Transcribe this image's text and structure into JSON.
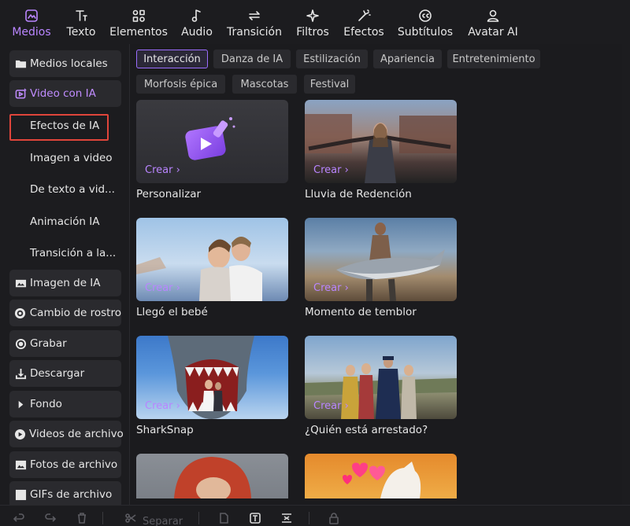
{
  "toolbar": {
    "items": [
      {
        "label": "Medios",
        "icon": "media-icon",
        "active": true
      },
      {
        "label": "Texto",
        "icon": "text-icon"
      },
      {
        "label": "Elementos",
        "icon": "elements-icon"
      },
      {
        "label": "Audio",
        "icon": "music-note-icon"
      },
      {
        "label": "Transición",
        "icon": "transition-arrows-icon"
      },
      {
        "label": "Filtros",
        "icon": "sparkle-icon"
      },
      {
        "label": "Efectos",
        "icon": "magic-effects-icon"
      },
      {
        "label": "Subtítulos",
        "icon": "subtitles-cc-icon"
      },
      {
        "label": "Avatar AI",
        "icon": "avatar-icon"
      }
    ]
  },
  "sidebar": {
    "local_media": "Medios locales",
    "video_ai": "Video con IA",
    "sub_items": [
      "Efectos de IA",
      "Imagen a video",
      "De texto a vid...",
      "Animación IA",
      "Transición a la..."
    ],
    "items": [
      {
        "label": "Imagen de IA",
        "icon": "ai-image-icon"
      },
      {
        "label": "Cambio de rostro",
        "icon": "face-swap-icon"
      },
      {
        "label": "Grabar",
        "icon": "record-icon"
      },
      {
        "label": "Descargar",
        "icon": "download-icon"
      },
      {
        "label": "Fondo",
        "icon": "caret-right-icon"
      },
      {
        "label": "Videos de archivo",
        "icon": "stock-video-icon"
      },
      {
        "label": "Fotos de archivo",
        "icon": "stock-photo-icon"
      },
      {
        "label": "GIFs de archivo",
        "icon": "gif-icon"
      }
    ]
  },
  "filters": {
    "chips": [
      "Interacción",
      "Danza de IA",
      "Estilización",
      "Apariencia",
      "Entretenimiento",
      "Morfosis épica",
      "Mascotas",
      "Festival"
    ],
    "active": "Interacción"
  },
  "cards": {
    "crear_label": "Crear ›",
    "items": [
      {
        "title": "Personalizar"
      },
      {
        "title": "Lluvia de Redención"
      },
      {
        "title": "Llegó el bebé"
      },
      {
        "title": "Momento de temblor"
      },
      {
        "title": "SharkSnap"
      },
      {
        "title": "¿Quién está arrestado?"
      },
      {
        "title": ""
      },
      {
        "title": ""
      }
    ]
  },
  "bottombar": {
    "split_label": "Separar"
  },
  "colors": {
    "accent": "#b985ff",
    "selection_border": "#e0453b",
    "background": "#1b1b1e",
    "chip_bg": "#2a2a2e"
  }
}
